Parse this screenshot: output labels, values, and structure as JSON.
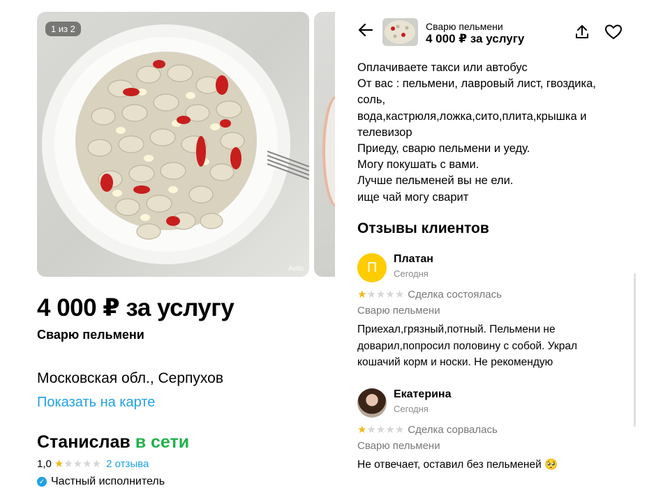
{
  "listing": {
    "photo_counter": "1 из 2",
    "watermark": "Avito",
    "price": "4 000 ₽ за услугу",
    "title": "Сварю пельмени",
    "location": "Московская обл., Серпухов",
    "map_link": "Показать на карте",
    "seller_name": "Станислав",
    "seller_status": "в сети",
    "seller_rating": "1,0",
    "seller_rating_value": 1,
    "seller_reviews_count": "2 отзыва",
    "seller_type": "Частный исполнитель"
  },
  "header": {
    "title": "Сварю пельмени",
    "price": "4 000 ₽ за услугу",
    "icons": [
      "back-arrow-icon",
      "share-icon",
      "heart-icon"
    ]
  },
  "description": {
    "lines": [
      "Оплачиваете такси или автобус",
      "От вас : пельмени, лавровый лист, гвоздика,",
      "соль,",
      "вода,кастрюля,ложка,сито,плита,крышка и",
      "телевизор",
      "Приеду, сварю пельмени и уеду.",
      "Могу покушать с вами.",
      "Лучше пельменей вы не ели.",
      "ище чай могу сварит"
    ]
  },
  "reviews": {
    "heading": "Отзывы клиентов",
    "items": [
      {
        "avatar_letter": "П",
        "name": "Платан",
        "date": "Сегодня",
        "rating": 1,
        "status": "Сделка состоялась",
        "item": "Сварю пельмени",
        "text_lines": [
          "Приехал,грязный,потный. Пельмени не",
          "доварил,попросил половину с собой. Украл",
          "кошачий корм и носки. Не рекомендую"
        ]
      },
      {
        "avatar_letter": "",
        "name": "Екатерина",
        "date": "Сегодня",
        "rating": 1,
        "status": "Сделка сорвалась",
        "item": "Сварю пельмени",
        "text_lines": [
          "Не отвечает, оставил без пельменей 🥺"
        ]
      }
    ]
  },
  "colors": {
    "link": "#1fa3e2",
    "online": "#21b14b",
    "star": "#f2b81b",
    "avatar_yellow": "#ffcc00"
  }
}
